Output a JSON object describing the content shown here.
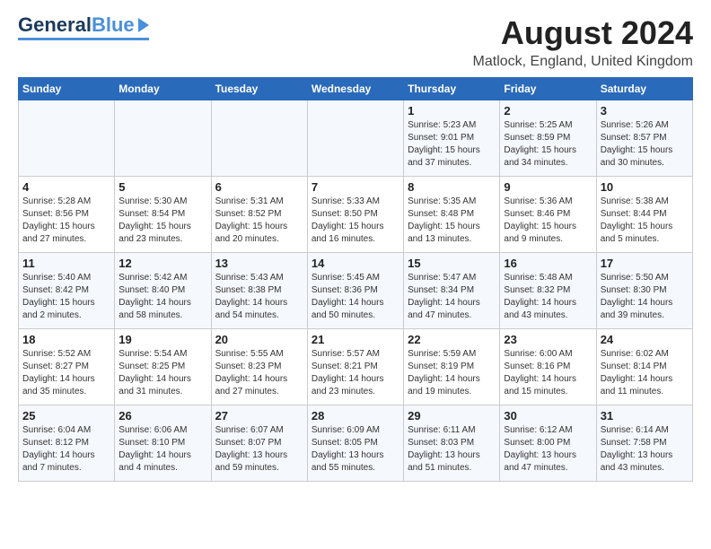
{
  "header": {
    "logo_line1": "General",
    "logo_line2": "Blue",
    "title": "August 2024",
    "subtitle": "Matlock, England, United Kingdom"
  },
  "weekdays": [
    "Sunday",
    "Monday",
    "Tuesday",
    "Wednesday",
    "Thursday",
    "Friday",
    "Saturday"
  ],
  "weeks": [
    [
      {
        "day": "",
        "info": ""
      },
      {
        "day": "",
        "info": ""
      },
      {
        "day": "",
        "info": ""
      },
      {
        "day": "",
        "info": ""
      },
      {
        "day": "1",
        "info": "Sunrise: 5:23 AM\nSunset: 9:01 PM\nDaylight: 15 hours\nand 37 minutes."
      },
      {
        "day": "2",
        "info": "Sunrise: 5:25 AM\nSunset: 8:59 PM\nDaylight: 15 hours\nand 34 minutes."
      },
      {
        "day": "3",
        "info": "Sunrise: 5:26 AM\nSunset: 8:57 PM\nDaylight: 15 hours\nand 30 minutes."
      }
    ],
    [
      {
        "day": "4",
        "info": "Sunrise: 5:28 AM\nSunset: 8:56 PM\nDaylight: 15 hours\nand 27 minutes."
      },
      {
        "day": "5",
        "info": "Sunrise: 5:30 AM\nSunset: 8:54 PM\nDaylight: 15 hours\nand 23 minutes."
      },
      {
        "day": "6",
        "info": "Sunrise: 5:31 AM\nSunset: 8:52 PM\nDaylight: 15 hours\nand 20 minutes."
      },
      {
        "day": "7",
        "info": "Sunrise: 5:33 AM\nSunset: 8:50 PM\nDaylight: 15 hours\nand 16 minutes."
      },
      {
        "day": "8",
        "info": "Sunrise: 5:35 AM\nSunset: 8:48 PM\nDaylight: 15 hours\nand 13 minutes."
      },
      {
        "day": "9",
        "info": "Sunrise: 5:36 AM\nSunset: 8:46 PM\nDaylight: 15 hours\nand 9 minutes."
      },
      {
        "day": "10",
        "info": "Sunrise: 5:38 AM\nSunset: 8:44 PM\nDaylight: 15 hours\nand 5 minutes."
      }
    ],
    [
      {
        "day": "11",
        "info": "Sunrise: 5:40 AM\nSunset: 8:42 PM\nDaylight: 15 hours\nand 2 minutes."
      },
      {
        "day": "12",
        "info": "Sunrise: 5:42 AM\nSunset: 8:40 PM\nDaylight: 14 hours\nand 58 minutes."
      },
      {
        "day": "13",
        "info": "Sunrise: 5:43 AM\nSunset: 8:38 PM\nDaylight: 14 hours\nand 54 minutes."
      },
      {
        "day": "14",
        "info": "Sunrise: 5:45 AM\nSunset: 8:36 PM\nDaylight: 14 hours\nand 50 minutes."
      },
      {
        "day": "15",
        "info": "Sunrise: 5:47 AM\nSunset: 8:34 PM\nDaylight: 14 hours\nand 47 minutes."
      },
      {
        "day": "16",
        "info": "Sunrise: 5:48 AM\nSunset: 8:32 PM\nDaylight: 14 hours\nand 43 minutes."
      },
      {
        "day": "17",
        "info": "Sunrise: 5:50 AM\nSunset: 8:30 PM\nDaylight: 14 hours\nand 39 minutes."
      }
    ],
    [
      {
        "day": "18",
        "info": "Sunrise: 5:52 AM\nSunset: 8:27 PM\nDaylight: 14 hours\nand 35 minutes."
      },
      {
        "day": "19",
        "info": "Sunrise: 5:54 AM\nSunset: 8:25 PM\nDaylight: 14 hours\nand 31 minutes."
      },
      {
        "day": "20",
        "info": "Sunrise: 5:55 AM\nSunset: 8:23 PM\nDaylight: 14 hours\nand 27 minutes."
      },
      {
        "day": "21",
        "info": "Sunrise: 5:57 AM\nSunset: 8:21 PM\nDaylight: 14 hours\nand 23 minutes."
      },
      {
        "day": "22",
        "info": "Sunrise: 5:59 AM\nSunset: 8:19 PM\nDaylight: 14 hours\nand 19 minutes."
      },
      {
        "day": "23",
        "info": "Sunrise: 6:00 AM\nSunset: 8:16 PM\nDaylight: 14 hours\nand 15 minutes."
      },
      {
        "day": "24",
        "info": "Sunrise: 6:02 AM\nSunset: 8:14 PM\nDaylight: 14 hours\nand 11 minutes."
      }
    ],
    [
      {
        "day": "25",
        "info": "Sunrise: 6:04 AM\nSunset: 8:12 PM\nDaylight: 14 hours\nand 7 minutes."
      },
      {
        "day": "26",
        "info": "Sunrise: 6:06 AM\nSunset: 8:10 PM\nDaylight: 14 hours\nand 4 minutes."
      },
      {
        "day": "27",
        "info": "Sunrise: 6:07 AM\nSunset: 8:07 PM\nDaylight: 13 hours\nand 59 minutes."
      },
      {
        "day": "28",
        "info": "Sunrise: 6:09 AM\nSunset: 8:05 PM\nDaylight: 13 hours\nand 55 minutes."
      },
      {
        "day": "29",
        "info": "Sunrise: 6:11 AM\nSunset: 8:03 PM\nDaylight: 13 hours\nand 51 minutes."
      },
      {
        "day": "30",
        "info": "Sunrise: 6:12 AM\nSunset: 8:00 PM\nDaylight: 13 hours\nand 47 minutes."
      },
      {
        "day": "31",
        "info": "Sunrise: 6:14 AM\nSunset: 7:58 PM\nDaylight: 13 hours\nand 43 minutes."
      }
    ]
  ]
}
